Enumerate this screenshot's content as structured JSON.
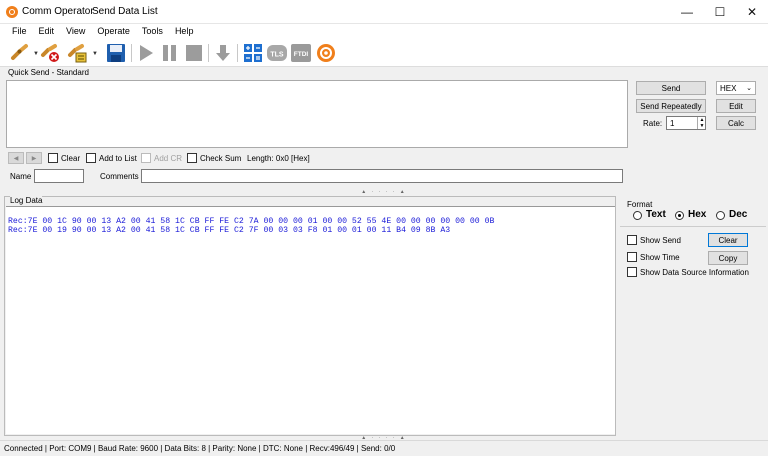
{
  "window": {
    "app_title": "Comm Operator",
    "doc_title": "Send Data List",
    "min_glyph": "—",
    "max_glyph": "☐",
    "close_glyph": "✕"
  },
  "menu": [
    "File",
    "Edit",
    "View",
    "Operate",
    "Tools",
    "Help"
  ],
  "toolbar": {
    "tls_label": "TLS",
    "ftdi_label": "FTDI",
    "icons": [
      "connect-icon",
      "disconnect-icon",
      "connect-settings-icon",
      "save-icon",
      "play-icon",
      "pause-icon",
      "stop-icon",
      "download-arrow-icon",
      "calculator-icon",
      "tls-icon",
      "ftdi-icon",
      "comm-operator-logo-icon"
    ]
  },
  "quick_send": {
    "label": "Quick Send - Standard",
    "send_label": "Send",
    "send_repeatedly_label": "Send Repeatedly",
    "mode_value": "HEX",
    "edit_label": "Edit",
    "rate_label": "Rate:",
    "rate_value": "1",
    "calc_label": "Calc",
    "clear_label": "Clear",
    "add_to_list_label": "Add to List",
    "add_cr_label": "Add CR",
    "check_sum_label": "Check Sum",
    "length_text": "Length: 0x0 [Hex]",
    "name_label": "Name",
    "comments_label": "Comments"
  },
  "log": {
    "label": "Log Data",
    "lines": [
      "Rec:7E 00 1C 90 00 13 A2 00 41 58 1C CB FF FE C2 7A 00 00 00 01 00 00 52 55 4E 00 00 00 00 00 00 0B",
      "Rec:7E 00 19 90 00 13 A2 00 41 58 1C CB FF FE C2 7F 00 03 03 F8 01 00 01 00 11 B4 09 8B A3"
    ]
  },
  "format_panel": {
    "label": "Format",
    "text_label": "Text",
    "hex_label": "Hex",
    "dec_label": "Dec",
    "selected": "Hex",
    "show_send_label": "Show Send",
    "show_time_label": "Show Time",
    "show_source_label": "Show Data Source Information",
    "clear_label": "Clear",
    "copy_label": "Copy"
  },
  "status": {
    "text": "Connected | Port: COM9 | Baud Rate: 9600 | Data Bits: 8 | Parity: None | DTC: None | Recv:496/49 | Send: 0/0"
  },
  "colors": {
    "log_text": "#1a1ad8",
    "accent_orange": "#f07f1b",
    "save_blue": "#1f5fae"
  }
}
